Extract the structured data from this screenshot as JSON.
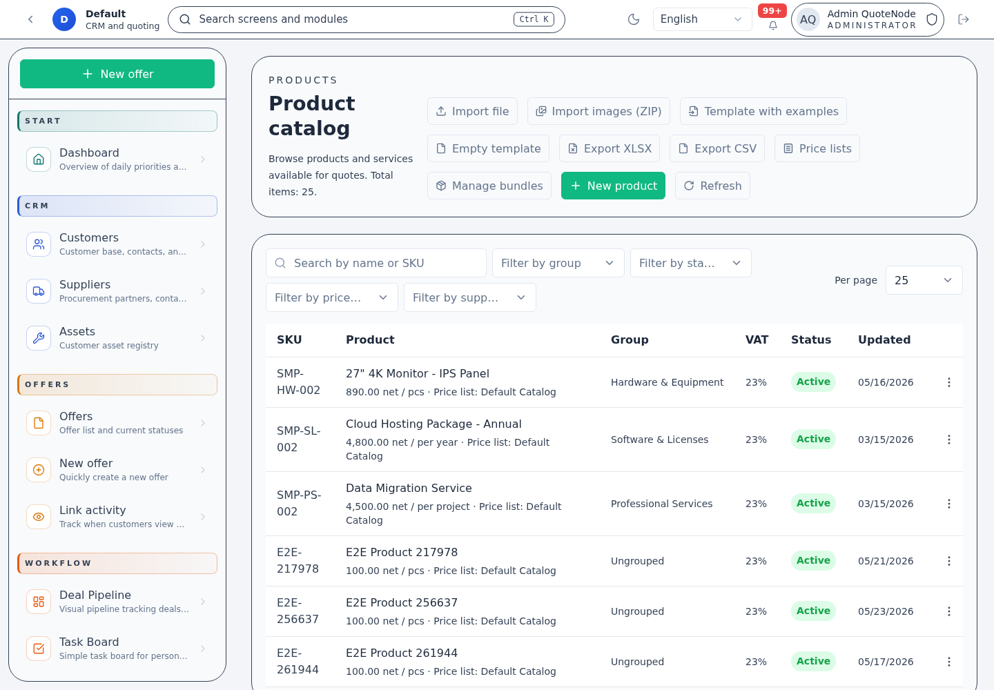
{
  "topbar": {
    "workspace": {
      "initial": "D",
      "name": "Default",
      "subtitle": "CRM and quoting"
    },
    "search": {
      "placeholder": "Search screens and modules",
      "shortcut": "Ctrl K"
    },
    "language": {
      "value": "English"
    },
    "notifications": {
      "badge": "99+"
    },
    "user": {
      "initials": "AQ",
      "name": "Admin QuoteNode",
      "role": "ADMINISTRATOR"
    }
  },
  "sidebar": {
    "new_offer_button": "New offer",
    "sections": [
      {
        "title": "START",
        "color": "#0f766e",
        "items": [
          {
            "title": "Dashboard",
            "description": "Overview of daily priorities a…"
          }
        ]
      },
      {
        "title": "CRM",
        "color": "#2f5bd3",
        "items": [
          {
            "title": "Customers",
            "description": "Customer base, contacts, an…"
          },
          {
            "title": "Suppliers",
            "description": "Procurement partners, conta…"
          },
          {
            "title": "Assets",
            "description": "Customer asset registry"
          }
        ]
      },
      {
        "title": "OFFERS",
        "color": "#d97706",
        "items": [
          {
            "title": "Offers",
            "description": "Offer list and current statuses"
          },
          {
            "title": "New offer",
            "description": "Quickly create a new offer"
          },
          {
            "title": "Link activity",
            "description": "Track when customers view …"
          }
        ]
      },
      {
        "title": "WORKFLOW",
        "color": "#ea580c",
        "items": [
          {
            "title": "Deal Pipeline",
            "description": "Visual pipeline tracking deals…"
          },
          {
            "title": "Task Board",
            "description": "Simple task board for person…"
          }
        ]
      }
    ]
  },
  "catalog_header": {
    "eyebrow": "PRODUCTS",
    "title": "Product catalog",
    "description": "Browse products and services available for quotes. Total items: 25.",
    "actions": [
      {
        "label": "Import file",
        "kind": "secondary"
      },
      {
        "label": "Import images (ZIP)",
        "kind": "secondary"
      },
      {
        "label": "Template with examples",
        "kind": "secondary"
      },
      {
        "label": "Empty template",
        "kind": "secondary"
      },
      {
        "label": "Export XLSX",
        "kind": "secondary"
      },
      {
        "label": "Export CSV",
        "kind": "secondary"
      },
      {
        "label": "Price lists",
        "kind": "secondary"
      },
      {
        "label": "Manage bundles",
        "kind": "secondary"
      },
      {
        "label": "New product",
        "kind": "primary"
      },
      {
        "label": "Refresh",
        "kind": "secondary"
      }
    ]
  },
  "product_list": {
    "search": {
      "placeholder": "Search by name or SKU"
    },
    "filters": [
      {
        "placeholder": "Filter by group"
      },
      {
        "placeholder": "Filter by sta…"
      },
      {
        "placeholder": "Filter by price…"
      },
      {
        "placeholder": "Filter by supp…"
      }
    ],
    "per_page": {
      "label": "Per page",
      "value": "25"
    },
    "table": {
      "columns": [
        "SKU",
        "Product",
        "Group",
        "VAT",
        "Status",
        "Updated"
      ],
      "rows": [
        {
          "sku": "SMP-HW-002",
          "name": "27\" 4K Monitor - IPS Panel",
          "details": "890.00 net / pcs · Price list: Default Catalog",
          "group": "Hardware & Equipment",
          "vat": "23%",
          "status": "Active",
          "updated": "05/16/2026"
        },
        {
          "sku": "SMP-SL-002",
          "name": "Cloud Hosting Package - Annual",
          "details": "4,800.00 net / per year · Price list: Default Catalog",
          "group": "Software & Licenses",
          "vat": "23%",
          "status": "Active",
          "updated": "03/15/2026"
        },
        {
          "sku": "SMP-PS-002",
          "name": "Data Migration Service",
          "details": "4,500.00 net / per project · Price list: Default Catalog",
          "group": "Professional Services",
          "vat": "23%",
          "status": "Active",
          "updated": "03/15/2026"
        },
        {
          "sku": "E2E-217978",
          "name": "E2E Product 217978",
          "details": "100.00 net / pcs · Price list: Default Catalog",
          "group": "Ungrouped",
          "vat": "23%",
          "status": "Active",
          "updated": "05/21/2026"
        },
        {
          "sku": "E2E-256637",
          "name": "E2E Product 256637",
          "details": "100.00 net / pcs · Price list: Default Catalog",
          "group": "Ungrouped",
          "vat": "23%",
          "status": "Active",
          "updated": "05/23/2026"
        },
        {
          "sku": "E2E-261944",
          "name": "E2E Product 261944",
          "details": "100.00 net / pcs · Price list: Default Catalog",
          "group": "Ungrouped",
          "vat": "23%",
          "status": "Active",
          "updated": "05/17/2026"
        }
      ]
    }
  }
}
